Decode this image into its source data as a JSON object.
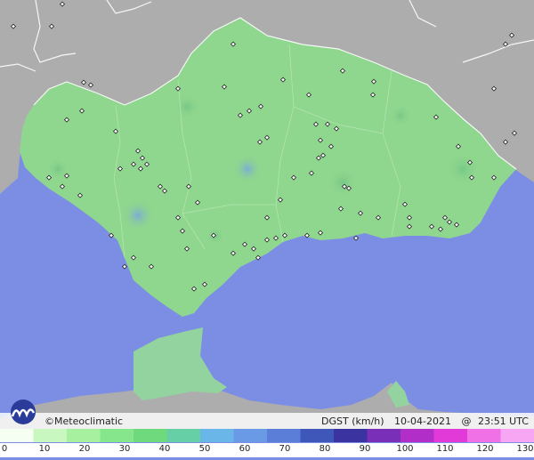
{
  "brand": {
    "name": "Meteoclimatic",
    "copyright": "©"
  },
  "map_info": {
    "variable": "DGST (km/h)",
    "date": "10-04-2021",
    "time": "23:51 UTC"
  },
  "legend": {
    "labels": [
      "0",
      "10",
      "20",
      "30",
      "40",
      "50",
      "60",
      "70",
      "80",
      "90",
      "100",
      "110",
      "120",
      "130"
    ],
    "colors": [
      "#f5fff2",
      "#c9f7c0",
      "#a7f0a0",
      "#86e68b",
      "#6fd97e",
      "#66cfa5",
      "#6ab6e8",
      "#6a99e6",
      "#5b7fd8",
      "#3e57b8",
      "#3a33a0",
      "#7a2fb8",
      "#b22ec8",
      "#e23ad8",
      "#f070e6",
      "#f6a6f2"
    ]
  },
  "colors": {
    "sea": "#7c8ee4",
    "land_gray": "#adadad",
    "andalusia": "#8fd68e"
  }
}
